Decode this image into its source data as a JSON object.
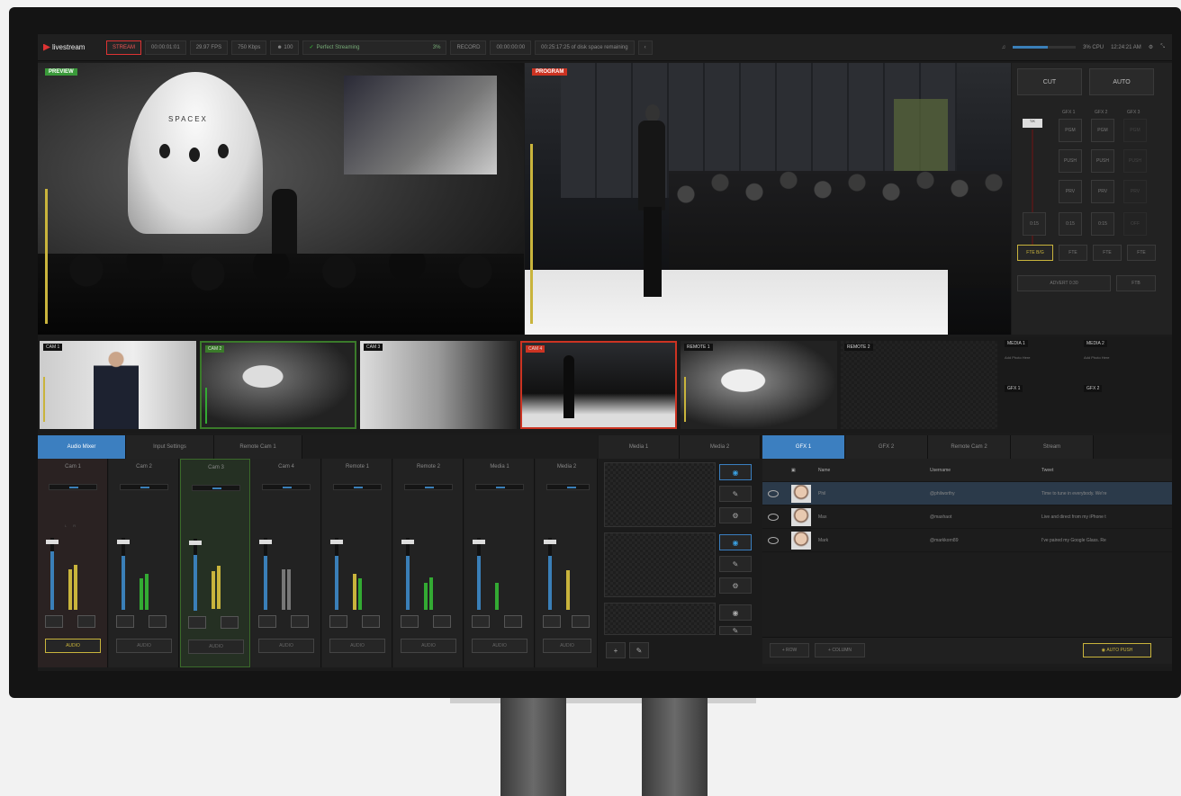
{
  "topbar": {
    "logo": "livestream",
    "stream_btn": "STREAM",
    "stream_time": "00:00:01:01",
    "fps": "29.97 FPS",
    "bitrate": "750 Kbps",
    "viewers": "100",
    "status": "Perfect Streaming",
    "status_pct": "3%",
    "record_btn": "RECORD",
    "record_time": "00:00:00:00",
    "disk": "00:25:17:25 of disk space remaining",
    "cpu": "3% CPU",
    "clock": "12:24:21 AM"
  },
  "preview": {
    "label": "PREVIEW",
    "capsule_text": "SPACEX"
  },
  "program": {
    "label": "PROGRAM"
  },
  "transition": {
    "cut": "CUT",
    "auto": "AUTO",
    "gfx_headers": [
      "GFX 1",
      "GFX 2",
      "GFX 3"
    ],
    "row1": [
      "PGM",
      "PGM",
      "PGM"
    ],
    "row2": [
      "PUSH",
      "PUSH",
      "PUSH"
    ],
    "row3": [
      "PRV",
      "PRV",
      "PRV"
    ],
    "row4": [
      "0:15",
      "0:15",
      "0:15",
      "OFF"
    ],
    "tbar_value": "T/K",
    "fte": [
      "FTE B/G",
      "FTE",
      "FTE",
      "FTE"
    ],
    "advert": "ADVERT 0:30",
    "ftb": "FTB"
  },
  "sources": [
    {
      "label": "CAM 1"
    },
    {
      "label": "CAM 2"
    },
    {
      "label": "CAM 3"
    },
    {
      "label": "CAM 4"
    },
    {
      "label": "REMOTE 1"
    },
    {
      "label": "REMOTE 2"
    }
  ],
  "media_sources": [
    {
      "label": "MEDIA 1",
      "sub": "Add Photo Here"
    },
    {
      "label": "MEDIA 2",
      "sub": "Add Photo Here"
    },
    {
      "label": "GFX 1"
    },
    {
      "label": "GFX 2"
    }
  ],
  "tabs_left": [
    "Audio Mixer",
    "Input Settings",
    "Remote Cam 1"
  ],
  "tabs_mid": [
    "Media 1",
    "Media 2"
  ],
  "tabs_right": [
    "GFX 1",
    "GFX 2",
    "Remote Cam 2",
    "Stream"
  ],
  "mixer": {
    "channels": [
      "Cam 1",
      "Cam 2",
      "Cam 3",
      "Cam 4",
      "Remote 1",
      "Remote 2",
      "Media 1",
      "Media 2"
    ],
    "audio_label": "AUDIO"
  },
  "gfx_table": {
    "headers": [
      "Name",
      "Username",
      "Tweet"
    ],
    "rows": [
      {
        "name": "Phil",
        "username": "@philworthy",
        "tweet": "Time to tune in everybody. We're"
      },
      {
        "name": "Max",
        "username": "@maxhaot",
        "tweet": "Live and direct from my iPhone t"
      },
      {
        "name": "Mark",
        "username": "@markkorn89",
        "tweet": "I've paired my Google Glass. Re"
      }
    ],
    "row_btn": "ROW",
    "column_btn": "COLUMN",
    "auto_push": "AUTO PUSH"
  },
  "colors": {
    "accent": "#3c7fc0",
    "live": "#cc3322",
    "preview": "#3a9a3a",
    "gold": "#c9b43c"
  }
}
